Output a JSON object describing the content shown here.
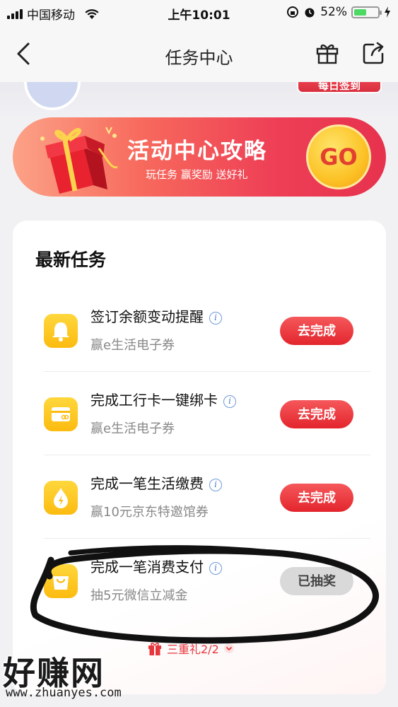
{
  "status_bar": {
    "carrier": "中国移动",
    "time": "上午10:01",
    "battery_percent": "52%",
    "battery_level": 0.52,
    "battery_color": "#4cd964"
  },
  "nav": {
    "title": "任务中心",
    "back_icon": "chevron-left-icon",
    "gift_icon": "gift-icon",
    "share_icon": "share-icon"
  },
  "top_area": {
    "checkin_label": "每日签到"
  },
  "banner": {
    "title": "活动中心攻略",
    "subtitle": "玩任务 赢奖励 送好礼",
    "go_label": "GO"
  },
  "task_card": {
    "title": "最新任务",
    "tasks": [
      {
        "title": "签订余额变动提醒",
        "desc": "赢e生活电子券",
        "button": "去完成",
        "icon": "bell-icon",
        "status": "pending"
      },
      {
        "title": "完成工行卡一键绑卡",
        "desc": "赢e生活电子券",
        "button": "去完成",
        "icon": "card-icon",
        "status": "pending"
      },
      {
        "title": "完成一笔生活缴费",
        "desc": "赢10元京东特邀馆券",
        "button": "去完成",
        "icon": "lightning-drop-icon",
        "status": "pending"
      },
      {
        "title": "完成一笔消费支付",
        "desc": "抽5元微信立减金",
        "button": "已抽奖",
        "icon": "shopping-bag-icon",
        "status": "done"
      }
    ],
    "triple_gift_label": "三重礼2/2"
  },
  "watermark": {
    "main": "好赚网",
    "url": "www.zhuanyes.com"
  },
  "colors": {
    "accent_red": "#e3252d",
    "icon_yellow": "#fcbb10",
    "banner_start": "#fca287",
    "banner_end": "#e7324e"
  }
}
